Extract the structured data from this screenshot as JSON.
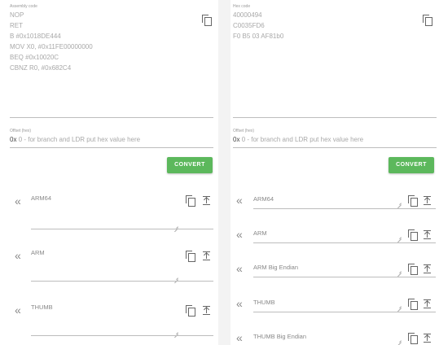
{
  "assembly": {
    "label": "Assembly code",
    "lines": [
      "NOP",
      "RET",
      "B #0x1018DE444",
      "MOV X0, #0x11FE00000000",
      "BEQ #0x10020C",
      "CBNZ R0, #0x682C4"
    ]
  },
  "hex": {
    "label": "Hex code",
    "lines": [
      "40000494",
      "C0035FD6",
      "F0 B5 03 AF81b0"
    ]
  },
  "offset_left": {
    "label": "Offset (hex)",
    "prefix": "0x",
    "placeholder": "0 - for branch and LDR put hex value here"
  },
  "offset_right": {
    "label": "Offset (hex)",
    "prefix": "0x",
    "placeholder": "0 - for branch and LDR put hex value here"
  },
  "convert_left": {
    "label": "CONVERT"
  },
  "convert_right": {
    "label": "CONVERT"
  },
  "outputs_left": [
    {
      "label": "ARM64"
    },
    {
      "label": "ARM"
    },
    {
      "label": "THUMB"
    }
  ],
  "outputs_right": [
    {
      "label": "ARM64"
    },
    {
      "label": "ARM"
    },
    {
      "label": "ARM Big Endian"
    },
    {
      "label": "THUMB"
    },
    {
      "label": "THUMB Big Endian"
    }
  ],
  "icons": {
    "collapse": "«",
    "copy": "copy-icon",
    "paste": "paste-icon",
    "resize": "resize-handle-icon"
  },
  "colors": {
    "accent": "#5cb85c",
    "divider": "#f3f3f3"
  }
}
